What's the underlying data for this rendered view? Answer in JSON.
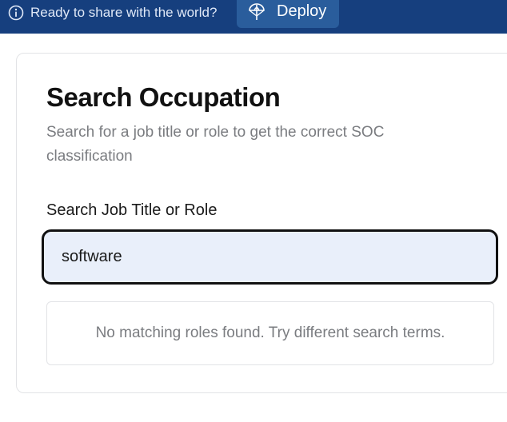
{
  "banner": {
    "info_icon": "info-circle-icon",
    "message": "Ready to share with the world?",
    "deploy_icon": "deploy-parachute-icon",
    "deploy_label": "Deploy",
    "background_color": "#163f7e"
  },
  "card": {
    "title": "Search Occupation",
    "subtitle": "Search for a job title or role to get the correct SOC classification",
    "search": {
      "label": "Search Job Title or Role",
      "value": "software",
      "placeholder": ""
    },
    "results": {
      "empty_message": "No matching roles found. Try different search terms."
    }
  }
}
